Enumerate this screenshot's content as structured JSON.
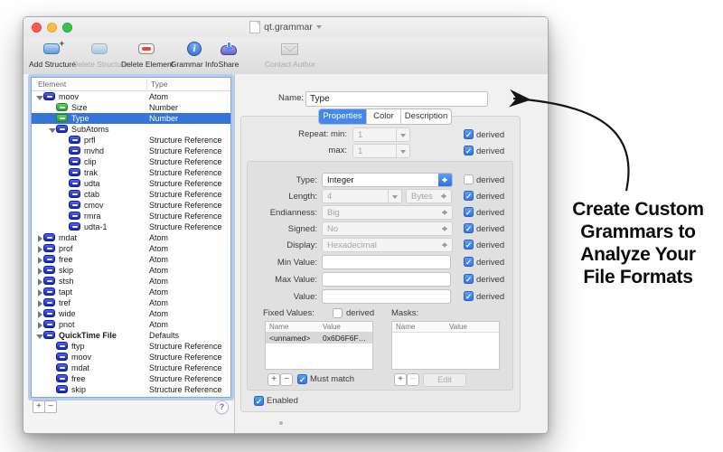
{
  "window": {
    "title": "qt.grammar"
  },
  "toolbar": {
    "items": [
      {
        "label": "Add Structure",
        "icon": "add-structure-icon",
        "enabled": true
      },
      {
        "label": "Delete Structure",
        "icon": "delete-structure-icon",
        "enabled": false
      },
      {
        "label": "Delete Element",
        "icon": "delete-element-icon",
        "enabled": true
      },
      {
        "label": "Grammar Info",
        "icon": "grammar-info-icon",
        "enabled": true
      },
      {
        "label": "Share",
        "icon": "share-icon",
        "enabled": true
      },
      {
        "label": "Contact Author",
        "icon": "contact-author-icon",
        "enabled": false
      }
    ]
  },
  "tree": {
    "columns": [
      "Element",
      "Type"
    ],
    "rows": [
      {
        "label": "moov",
        "type": "Atom",
        "level": 0,
        "disc": "expanded",
        "icon": "blue",
        "selected": false,
        "bold": false
      },
      {
        "label": "Size",
        "type": "Number",
        "level": 1,
        "disc": null,
        "icon": "green",
        "selected": false,
        "bold": false
      },
      {
        "label": "Type",
        "type": "Number",
        "level": 1,
        "disc": null,
        "icon": "green",
        "selected": true,
        "bold": false
      },
      {
        "label": "SubAtoms",
        "type": "",
        "level": 1,
        "disc": "expanded",
        "icon": "blue",
        "selected": false,
        "bold": false
      },
      {
        "label": "prfl",
        "type": "Structure Reference",
        "level": 2,
        "disc": null,
        "icon": "blue",
        "selected": false,
        "bold": false
      },
      {
        "label": "mvhd",
        "type": "Structure Reference",
        "level": 2,
        "disc": null,
        "icon": "blue",
        "selected": false,
        "bold": false
      },
      {
        "label": "clip",
        "type": "Structure Reference",
        "level": 2,
        "disc": null,
        "icon": "blue",
        "selected": false,
        "bold": false
      },
      {
        "label": "trak",
        "type": "Structure Reference",
        "level": 2,
        "disc": null,
        "icon": "blue",
        "selected": false,
        "bold": false
      },
      {
        "label": "udta",
        "type": "Structure Reference",
        "level": 2,
        "disc": null,
        "icon": "blue",
        "selected": false,
        "bold": false
      },
      {
        "label": "ctab",
        "type": "Structure Reference",
        "level": 2,
        "disc": null,
        "icon": "blue",
        "selected": false,
        "bold": false
      },
      {
        "label": "cmov",
        "type": "Structure Reference",
        "level": 2,
        "disc": null,
        "icon": "blue",
        "selected": false,
        "bold": false
      },
      {
        "label": "rmra",
        "type": "Structure Reference",
        "level": 2,
        "disc": null,
        "icon": "blue",
        "selected": false,
        "bold": false
      },
      {
        "label": "udta-1",
        "type": "Structure Reference",
        "level": 2,
        "disc": null,
        "icon": "blue",
        "selected": false,
        "bold": false
      },
      {
        "label": "mdat",
        "type": "Atom",
        "level": 0,
        "disc": "collapsed",
        "icon": "blue",
        "selected": false,
        "bold": false
      },
      {
        "label": "prof",
        "type": "Atom",
        "level": 0,
        "disc": "collapsed",
        "icon": "blue",
        "selected": false,
        "bold": false
      },
      {
        "label": "free",
        "type": "Atom",
        "level": 0,
        "disc": "collapsed",
        "icon": "blue",
        "selected": false,
        "bold": false
      },
      {
        "label": "skip",
        "type": "Atom",
        "level": 0,
        "disc": "collapsed",
        "icon": "blue",
        "selected": false,
        "bold": false
      },
      {
        "label": "stsh",
        "type": "Atom",
        "level": 0,
        "disc": "collapsed",
        "icon": "blue",
        "selected": false,
        "bold": false
      },
      {
        "label": "tapt",
        "type": "Atom",
        "level": 0,
        "disc": "collapsed",
        "icon": "blue",
        "selected": false,
        "bold": false
      },
      {
        "label": "tref",
        "type": "Atom",
        "level": 0,
        "disc": "collapsed",
        "icon": "blue",
        "selected": false,
        "bold": false
      },
      {
        "label": "wide",
        "type": "Atom",
        "level": 0,
        "disc": "collapsed",
        "icon": "blue",
        "selected": false,
        "bold": false
      },
      {
        "label": "pnot",
        "type": "Atom",
        "level": 0,
        "disc": "collapsed",
        "icon": "blue",
        "selected": false,
        "bold": false
      },
      {
        "label": "QuickTime File",
        "type": "Defaults",
        "level": 0,
        "disc": "expanded",
        "icon": "blue",
        "selected": false,
        "bold": true
      },
      {
        "label": "ftyp",
        "type": "Structure Reference",
        "level": 1,
        "disc": null,
        "icon": "blue",
        "selected": false,
        "bold": false
      },
      {
        "label": "moov",
        "type": "Structure Reference",
        "level": 1,
        "disc": null,
        "icon": "blue",
        "selected": false,
        "bold": false
      },
      {
        "label": "mdat",
        "type": "Structure Reference",
        "level": 1,
        "disc": null,
        "icon": "blue",
        "selected": false,
        "bold": false
      },
      {
        "label": "free",
        "type": "Structure Reference",
        "level": 1,
        "disc": null,
        "icon": "blue",
        "selected": false,
        "bold": false
      },
      {
        "label": "skip",
        "type": "Structure Reference",
        "level": 1,
        "disc": null,
        "icon": "blue",
        "selected": false,
        "bold": false
      }
    ],
    "footer": {
      "add": "+",
      "remove": "−",
      "help": "?"
    }
  },
  "panel": {
    "name_label": "Name:",
    "name_value": "Type",
    "tabs": [
      {
        "label": "Properties",
        "selected": true
      },
      {
        "label": "Color",
        "selected": false
      },
      {
        "label": "Description",
        "selected": false
      }
    ],
    "derived_label": "derived",
    "repeat_rows": [
      {
        "label": "Repeat: min:",
        "value": "1",
        "derived": true
      },
      {
        "label": "max:",
        "value": "1",
        "derived": true
      }
    ],
    "form_rows": [
      {
        "label": "Type:",
        "value": "Integer",
        "control": "popup-active",
        "derived": false
      },
      {
        "label": "Length:",
        "value": "4",
        "control": "combo-unit",
        "unit": "Bytes",
        "derived": true
      },
      {
        "label": "Endianness:",
        "value": "Big",
        "control": "popup",
        "derived": true
      },
      {
        "label": "Signed:",
        "value": "No",
        "control": "popup",
        "derived": true
      },
      {
        "label": "Display:",
        "value": "Hexadecimal",
        "control": "popup",
        "derived": true
      },
      {
        "label": "Min Value:",
        "value": "",
        "control": "text",
        "derived": true
      },
      {
        "label": "Max Value:",
        "value": "",
        "control": "text",
        "derived": true
      },
      {
        "label": "Value:",
        "value": "",
        "control": "text",
        "derived": true
      }
    ],
    "fixed_values": {
      "label": "Fixed Values:",
      "derived": false,
      "columns": [
        "Name",
        "Value"
      ],
      "rows": [
        {
          "name": "<unnamed>",
          "value": "0x6D6F6F…"
        }
      ],
      "add": "+",
      "remove": "−",
      "must_match_label": "Must match",
      "must_match": true
    },
    "masks": {
      "label": "Masks:",
      "columns": [
        "Name",
        "Value"
      ],
      "rows": [],
      "add": "+",
      "remove": "−",
      "edit_label": "Edit"
    },
    "enabled_label": "Enabled",
    "enabled": true
  },
  "annotation": {
    "lines": [
      "Create Custom",
      "Grammars to",
      "Analyze Your",
      "File Formats"
    ]
  },
  "colors": {
    "accent_blue": "#4189f1",
    "selection_blue": "#3574d9",
    "tree_icon_blue": "#1726b4",
    "tree_icon_green": "#2b9e33",
    "delete_red": "#e04844"
  }
}
